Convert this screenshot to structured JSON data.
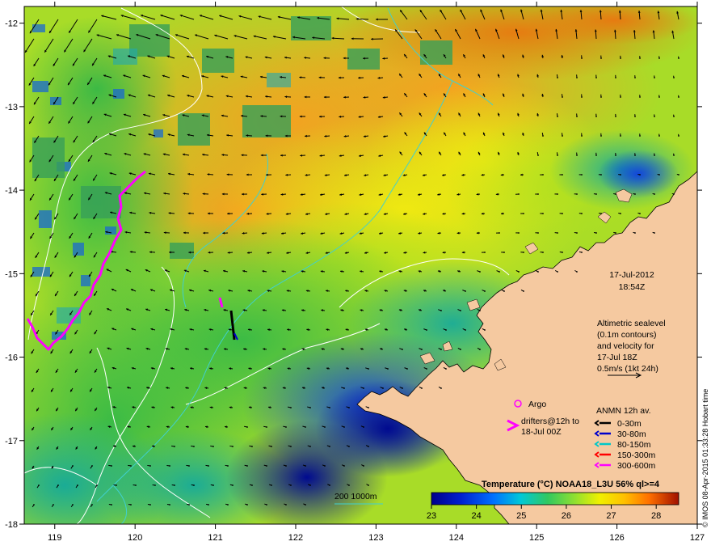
{
  "map": {
    "date": "17-Jul-2012",
    "time": "18:54Z",
    "x_ticks": [
      "119",
      "120",
      "121",
      "122",
      "123",
      "124",
      "125",
      "126",
      "127"
    ],
    "y_ticks": [
      "-12",
      "-13",
      "-14",
      "-15",
      "-16",
      "-17",
      "-18"
    ],
    "sealevel_note": [
      "Altimetric sealevel",
      "(0.1m contours)",
      "and velocity for",
      "17-Jul 18Z",
      "0.5m/s (1kt 24h)"
    ],
    "argo_label": "Argo",
    "drifters_label": [
      "drifters@12h to",
      "18-Jul 00Z"
    ],
    "depth_contours_label": "200  1000m",
    "anmn": {
      "title": "ANMN 12h av.",
      "items": [
        {
          "label": "0-30m",
          "color": "#000000"
        },
        {
          "label": "30-80m",
          "color": "#0000cc"
        },
        {
          "label": "80-150m",
          "color": "#00c8c8"
        },
        {
          "label": "150-300m",
          "color": "#ff0000"
        },
        {
          "label": "300-600m",
          "color": "#ff00ff"
        }
      ]
    },
    "colorbar": {
      "title": "Temperature (°C) NOAA18_L3U 56% ql>=4",
      "ticks": [
        "23",
        "24",
        "25",
        "26",
        "27",
        "28"
      ],
      "min": 23,
      "max": 28.5
    },
    "credit": "© IMOS 08-Apr-2015 01:33:28 Hobart time",
    "colors": {
      "land": "#f5c9a0",
      "drifter": "#ff00ff",
      "contour": "#ffffff",
      "isobath": "#40d0d0"
    }
  }
}
